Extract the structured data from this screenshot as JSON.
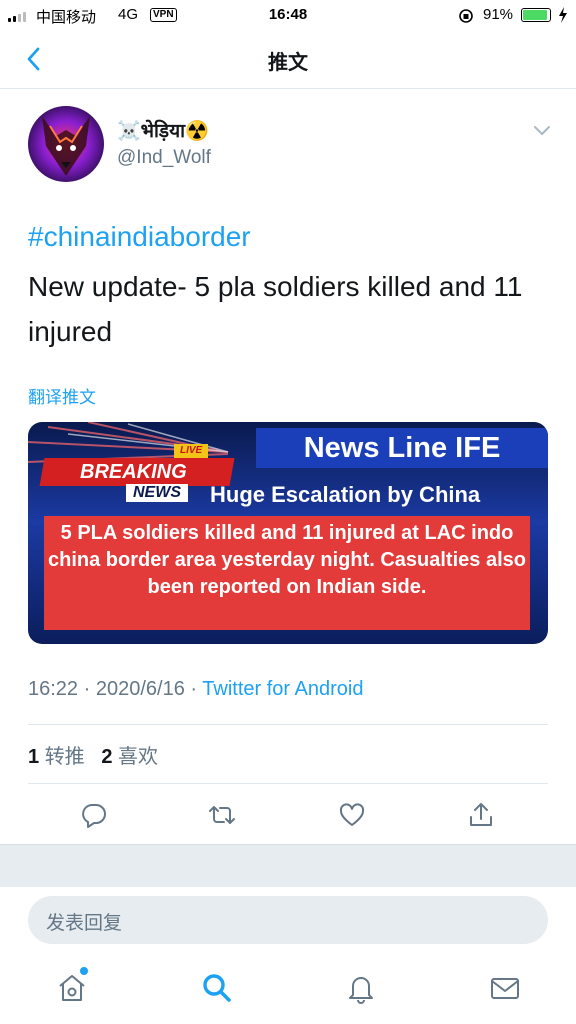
{
  "status_bar": {
    "carrier": "中国移动",
    "network": "4G",
    "vpn": "VPN",
    "time": "16:48",
    "battery_percent": "91%",
    "battery_level": 0.91
  },
  "nav": {
    "title": "推文"
  },
  "tweet": {
    "display_name": "☠️भेड़िया☢️",
    "handle": "@Ind_Wolf",
    "hashtag": "#chinaindiaborder",
    "text": "New update- 5 pla soldiers killed and 11 injured",
    "translate_label": "翻译推文",
    "time": "16:22",
    "date": "2020/6/16",
    "separator": "·",
    "source": "Twitter for Android",
    "retweet_count": "1",
    "retweet_label": "转推",
    "like_count": "2",
    "like_label": "喜欢"
  },
  "media": {
    "channel": "News Line IFE",
    "live_tag": "LIVE",
    "breaking": "BREAKING",
    "news_tag": "NEWS",
    "headline": "Huge Escalation by China",
    "body": "5 PLA soldiers killed and 11 injured at LAC indo china border area yesterday night. Casualties also been reported on Indian side."
  },
  "reply": {
    "placeholder": "发表回复"
  },
  "colors": {
    "accent": "#1da1f2",
    "muted": "#657786",
    "separator": "#e6ecf0"
  },
  "icons": [
    "back-chevron-icon",
    "caret-down-icon",
    "reply-icon",
    "retweet-icon",
    "like-icon",
    "share-icon",
    "home-icon",
    "search-icon",
    "notifications-icon",
    "messages-icon"
  ]
}
